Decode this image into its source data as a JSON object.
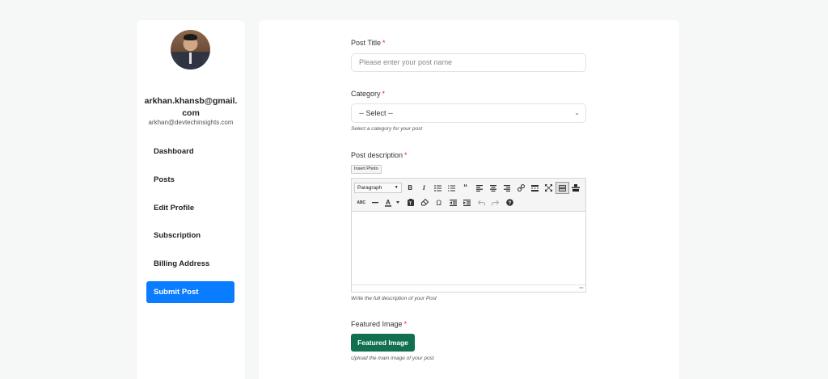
{
  "sidebar": {
    "user_name": "arkhan.khansb@gmail.com",
    "user_email": "arkhan@devtechinsights.com",
    "items": [
      {
        "label": "Dashboard",
        "active": false
      },
      {
        "label": "Posts",
        "active": false
      },
      {
        "label": "Edit Profile",
        "active": false
      },
      {
        "label": "Subscription",
        "active": false
      },
      {
        "label": "Billing Address",
        "active": false
      },
      {
        "label": "Submit Post",
        "active": true
      }
    ]
  },
  "form": {
    "post_title": {
      "label": "Post Title",
      "required_mark": "*",
      "placeholder": "Please enter your post name"
    },
    "category": {
      "label": "Category",
      "required_mark": "*",
      "selected": "-- Select --",
      "help": "Select a category for your post"
    },
    "description": {
      "label": "Post description",
      "required_mark": "*",
      "insert_photo_label": "Insert Photo",
      "format_select": "Paragraph",
      "help": "Write the full description of your Post"
    },
    "featured_image": {
      "label": "Featured Image",
      "required_mark": "*",
      "button_label": "Featured Image",
      "help": "Upload the main image of your post"
    }
  },
  "toolbar": {
    "row1_icons": [
      "bold-icon",
      "italic-icon",
      "bullet-list-icon",
      "numbered-list-icon",
      "blockquote-icon",
      "align-left-icon",
      "align-center-icon",
      "align-right-icon",
      "link-icon",
      "read-more-icon",
      "fullscreen-icon",
      "toolbar-toggle-icon",
      "kitchen-sink-icon"
    ],
    "row2_icons": [
      "strikethrough-icon",
      "horizontal-line-icon",
      "text-color-icon",
      "paste-text-icon",
      "clear-formatting-icon",
      "special-character-icon",
      "outdent-icon",
      "indent-icon",
      "undo-icon",
      "redo-icon",
      "help-icon"
    ]
  },
  "colors": {
    "accent": "#0a7cff",
    "featured_button": "#10704f",
    "required": "#e0242b",
    "background": "#f6f8f7"
  }
}
